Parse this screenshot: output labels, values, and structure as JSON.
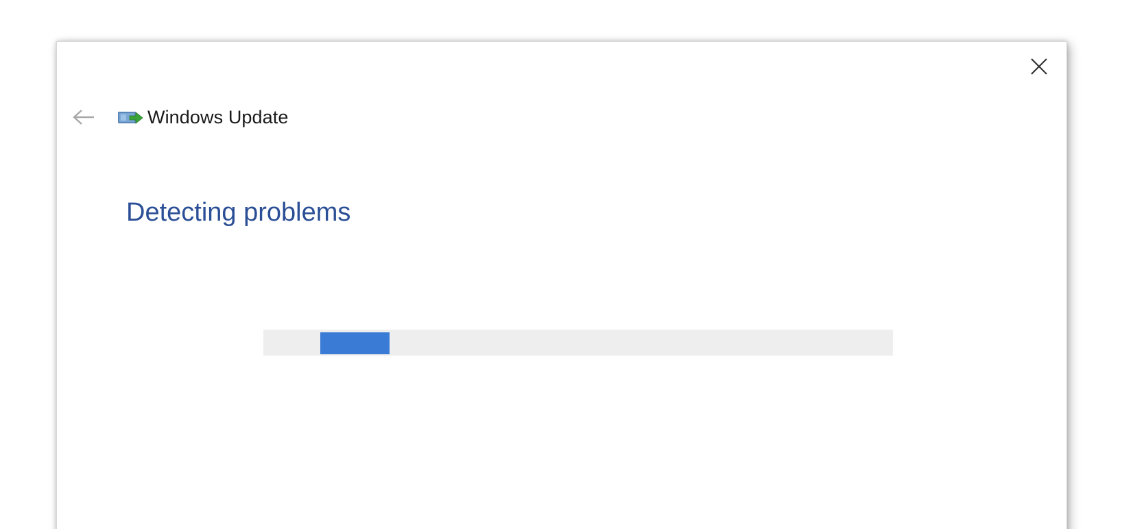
{
  "window": {
    "app_title": "Windows Update",
    "close_icon": "close-icon",
    "back_icon": "back-arrow-icon",
    "app_icon": "windows-update-icon"
  },
  "main": {
    "heading": "Detecting problems"
  },
  "progress": {
    "mode": "indeterminate",
    "chunk_start_fraction": 0.09,
    "chunk_width_fraction": 0.11
  },
  "colors": {
    "heading": "#2b4f96",
    "progress_chunk": "#3a7bd5",
    "progress_track": "#eeeeee",
    "back_arrow": "#a8a8a8"
  }
}
